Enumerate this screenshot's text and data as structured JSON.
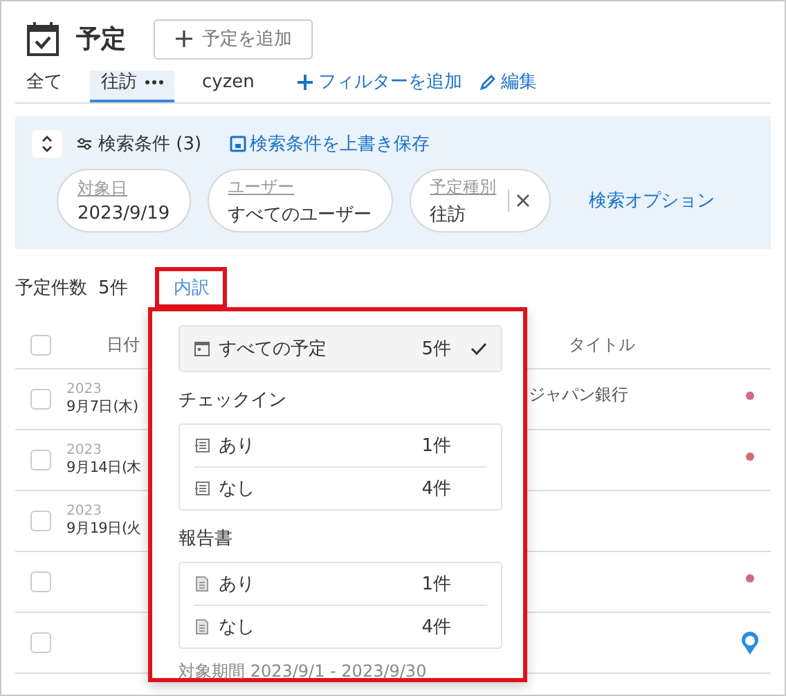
{
  "page": {
    "title": "予定",
    "add_button": "予定を追加"
  },
  "tabs": [
    {
      "label": "全て",
      "selected": false,
      "menu": false
    },
    {
      "label": "往訪",
      "selected": true,
      "menu": true
    },
    {
      "label": "cyzen",
      "selected": false,
      "menu": false
    }
  ],
  "tab_actions": {
    "add_filter": "フィルターを追加",
    "edit": "編集"
  },
  "search": {
    "label": "検索条件 (3)",
    "save": "検索条件を上書き保存",
    "options": "検索オプション",
    "chips": [
      {
        "label": "対象日",
        "value": "2023/9/19",
        "clearable": false
      },
      {
        "label": "ユーザー",
        "value": "すべてのユーザー",
        "clearable": false
      },
      {
        "label": "予定種別",
        "value": "往訪",
        "clearable": true
      }
    ]
  },
  "summary": {
    "label": "予定件数",
    "count": "5件",
    "breakdown_link": "内訳"
  },
  "table": {
    "columns": [
      "日付",
      "タイトル"
    ],
    "all_checked": false,
    "rows": [
      {
        "checked": false,
        "year": "2023",
        "date": "9月7日(木)",
        "title": "ジャパン銀行",
        "kind": "dot"
      },
      {
        "checked": false,
        "year": "2023",
        "date": "9月14日(木",
        "kind": "dot"
      },
      {
        "checked": false,
        "year": "2023",
        "date": "9月19日(火",
        "kind": "plain"
      },
      {
        "checked": false,
        "kind": "dot"
      },
      {
        "checked": false,
        "kind": "pin"
      }
    ]
  },
  "breakdown": {
    "all": {
      "label": "すべての予定",
      "count": "5件",
      "selected": true
    },
    "groups": [
      {
        "title": "チェックイン",
        "kind": "checkin",
        "items": [
          {
            "label": "あり",
            "count": "1件"
          },
          {
            "label": "なし",
            "count": "4件"
          }
        ]
      },
      {
        "title": "報告書",
        "kind": "report",
        "items": [
          {
            "label": "あり",
            "count": "1件"
          },
          {
            "label": "なし",
            "count": "4件"
          }
        ]
      }
    ],
    "period": "対象期間 2023/9/1 - 2023/9/30"
  }
}
